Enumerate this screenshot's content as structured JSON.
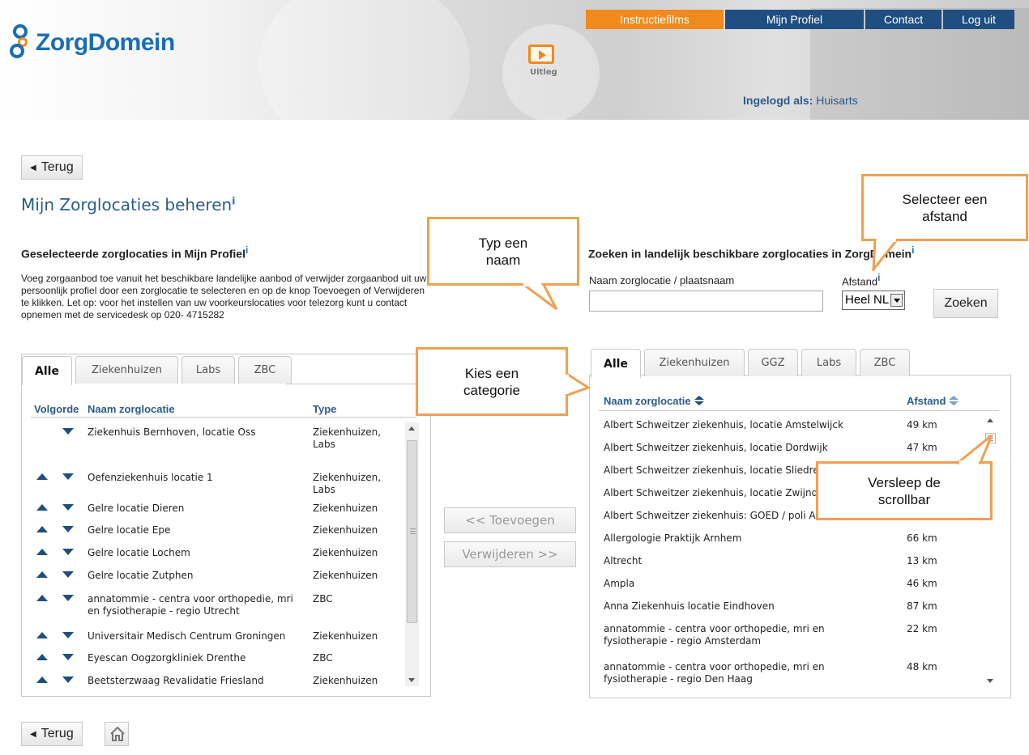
{
  "header": {
    "logo_text": "ZorgDomein",
    "video_label": "Uitleg",
    "nav": [
      {
        "label": "Instructiefilms",
        "active": true
      },
      {
        "label": "Mijn Profiel",
        "active": false
      },
      {
        "label": "Contact",
        "active": false
      },
      {
        "label": "Log uit",
        "active": false
      }
    ],
    "logged_in_label": "Ingelogd als:",
    "logged_in_role": "Huisarts"
  },
  "back_button": "Terug",
  "page_title": "Mijn Zorglocaties beheren",
  "info_marker": "i",
  "left": {
    "heading": "Geselecteerde zorglocaties in Mijn Profiel",
    "intro": "Voeg zorgaanbod toe vanuit het beschikbare landelijke aanbod of verwijder zorgaanbod uit uw persoonlijk profiel door een zorglocatie te selecteren en op de knop Toevoegen of Verwijderen te klikken. Let op: voor het instellen van uw voorkeurslocaties voor telezorg kunt u contact opnemen met de servicedesk op 020- 4715282",
    "tabs": [
      "Alle",
      "Ziekenhuizen",
      "Labs",
      "ZBC"
    ],
    "columns": {
      "order": "Volgorde",
      "name": "Naam zorglocatie",
      "type": "Type"
    },
    "rows": [
      {
        "name": "Ziekenhuis Bernhoven, locatie Oss",
        "type": "Ziekenhuizen, Labs"
      },
      {
        "name": "Oefenziekenhuis locatie 1",
        "type": "Ziekenhuizen, Labs"
      },
      {
        "name": "Gelre locatie Dieren",
        "type": "Ziekenhuizen"
      },
      {
        "name": "Gelre locatie Epe",
        "type": "Ziekenhuizen"
      },
      {
        "name": "Gelre locatie Lochem",
        "type": "Ziekenhuizen"
      },
      {
        "name": "Gelre locatie Zutphen",
        "type": "Ziekenhuizen"
      },
      {
        "name": "annatommie - centra voor orthopedie, mri en fysiotherapie - regio Utrecht",
        "type": "ZBC"
      },
      {
        "name": "Universitair Medisch Centrum Groningen",
        "type": "Ziekenhuizen"
      },
      {
        "name": "Eyescan Oogzorgkliniek Drenthe",
        "type": "ZBC"
      },
      {
        "name": "Beetsterzwaag Revalidatie Friesland",
        "type": "Ziekenhuizen"
      }
    ]
  },
  "middle": {
    "add_label": "<< Toevoegen",
    "remove_label": "Verwijderen >>"
  },
  "right": {
    "heading": "Zoeken in landelijk beschikbare zorglocaties in ZorgDomein",
    "search_label": "Naam zorglocatie / plaatsnaam",
    "search_value": "",
    "distance_label": "Afstand",
    "distance_value": "Heel NL",
    "search_button": "Zoeken",
    "tabs": [
      "Alle",
      "Ziekenhuizen",
      "GGZ",
      "Labs",
      "ZBC"
    ],
    "columns": {
      "name": "Naam zorglocatie",
      "distance": "Afstand"
    },
    "rows": [
      {
        "name": "Albert Schweitzer ziekenhuis, locatie Amstelwijck",
        "distance": "49 km"
      },
      {
        "name": "Albert Schweitzer ziekenhuis, locatie Dordwijk",
        "distance": "47 km"
      },
      {
        "name": "Albert Schweitzer ziekenhuis, locatie Sliedrecht",
        "distance": ""
      },
      {
        "name": "Albert Schweitzer ziekenhuis, locatie Zwijndrecht",
        "distance": ""
      },
      {
        "name": "Albert Schweitzer ziekenhuis: GOED / poli AZL",
        "distance": ""
      },
      {
        "name": "Allergologie Praktijk Arnhem",
        "distance": "66 km"
      },
      {
        "name": "Altrecht",
        "distance": "13 km"
      },
      {
        "name": "Ampla",
        "distance": "46 km"
      },
      {
        "name": "Anna Ziekenhuis locatie Eindhoven",
        "distance": "87 km"
      },
      {
        "name": "annatommie - centra voor orthopedie, mri en fysiotherapie - regio Amsterdam",
        "distance": "22 km"
      },
      {
        "name": "annatommie - centra voor orthopedie, mri en fysiotherapie - regio Den Haag",
        "distance": "48 km"
      }
    ]
  },
  "callouts": {
    "name": "Typ een naam",
    "distance": "Selecteer een afstand",
    "category": "Kies een categorie",
    "scrollbar": "Versleep de scrollbar"
  },
  "colors": {
    "accent_orange": "#f08a1c",
    "nav_blue": "#1f4e80",
    "title_blue": "#2b5b8a",
    "callout_border": "#f0a050"
  }
}
